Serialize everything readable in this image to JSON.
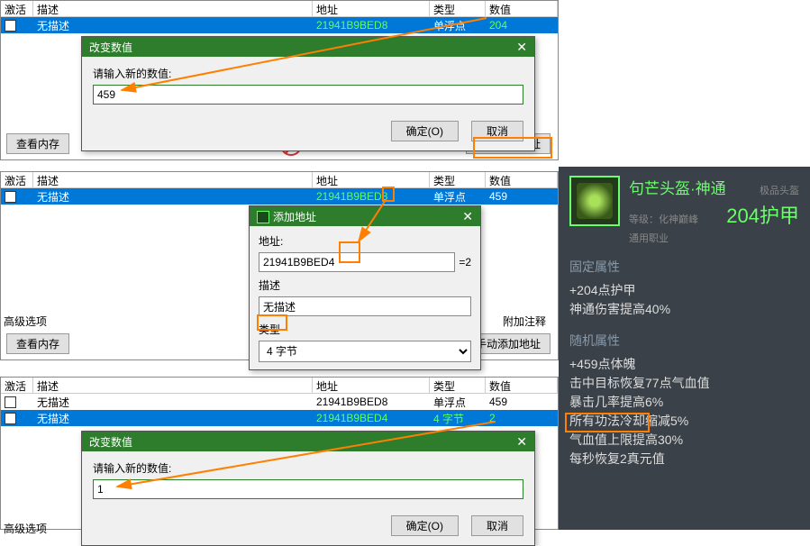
{
  "headers": {
    "activate": "激活",
    "desc": "描述",
    "addr": "地址",
    "type": "类型",
    "value": "数值"
  },
  "buttons": {
    "view_mem": "查看内存",
    "manual_add": "手动添加地址",
    "ok": "确定(O)",
    "cancel": "取消",
    "attach_note": "附加注释"
  },
  "labels": {
    "adv_options": "高级选项"
  },
  "panel1": {
    "rows": [
      {
        "desc": "无描述",
        "addr": "21941B9BED8",
        "type": "单浮点",
        "value": "204",
        "sel": true
      }
    ]
  },
  "panel2": {
    "rows": [
      {
        "desc": "无描述",
        "addr": "21941B9BED8",
        "type": "单浮点",
        "value": "459",
        "sel": true
      }
    ]
  },
  "panel3": {
    "rows": [
      {
        "desc": "无描述",
        "addr": "21941B9BED8",
        "type": "单浮点",
        "value": "459",
        "sel": false
      },
      {
        "desc": "无描述",
        "addr": "21941B9BED4",
        "type": "4 字节",
        "value": "2",
        "sel": true
      }
    ]
  },
  "dialog1": {
    "title": "改变数值",
    "prompt": "请输入新的数值:",
    "value": "459"
  },
  "dialog2": {
    "title": "添加地址",
    "addr_label": "地址:",
    "addr": "21941B9BED4",
    "eq": "=2",
    "desc_label": "描述",
    "desc": "无描述",
    "type_label": "类型",
    "type": "4 字节"
  },
  "dialog3": {
    "title": "改变数值",
    "prompt": "请输入新的数值:",
    "value": "1"
  },
  "item": {
    "name": "句芒头盔·神通",
    "quality": "极品头盔",
    "level_label": "等级：",
    "level": "化神巅峰",
    "armor": "204护甲",
    "job": "通用职业",
    "fixed_title": "固定属性",
    "fixed": [
      "+204点护甲",
      "神通伤害提高40%"
    ],
    "rand_title": "随机属性",
    "rand": [
      "+459点体魄",
      "击中目标恢复77点气血值",
      "暴击几率提高6%",
      "所有功法冷却缩减5%",
      "气血值上限提高30%",
      "每秒恢复2真元值"
    ]
  }
}
